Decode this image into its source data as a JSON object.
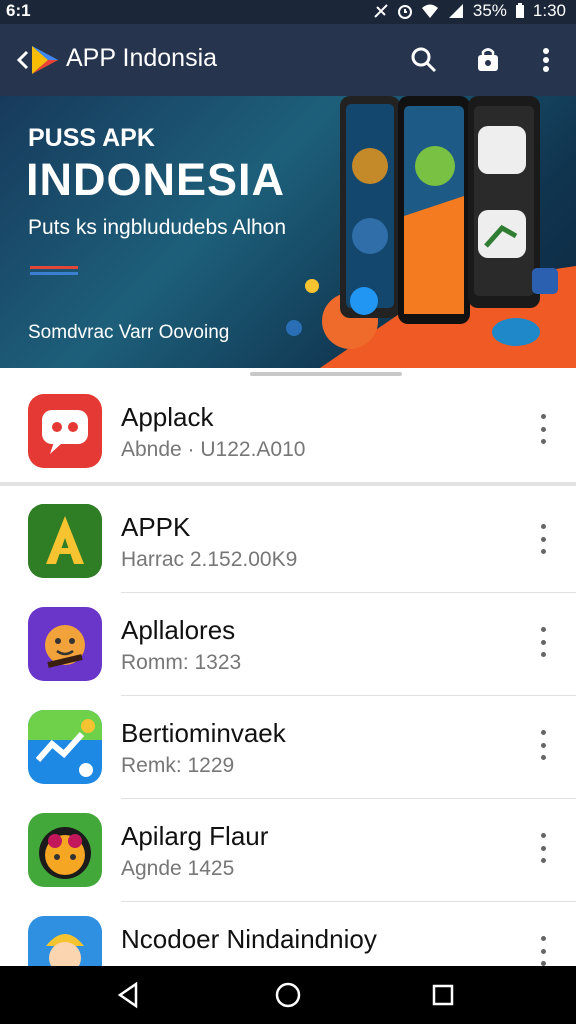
{
  "status_bar": {
    "time_left": "6:1",
    "battery": "35%",
    "clock": "1:30"
  },
  "app_bar": {
    "title": "APP Indonsia",
    "icons": [
      "back-arrow-icon",
      "app-logo-icon",
      "search-icon",
      "bag-icon",
      "more-vert-icon"
    ]
  },
  "banner": {
    "line1": "PUSS APK",
    "line2": "INDONESIA",
    "line3": "Puts ks ingblududebs Alhon",
    "line4": "Somdvrac Varr Oovoing"
  },
  "apps": [
    {
      "name": "Applack",
      "meta": "Abnde · U122.A010",
      "icon": "chat-bubble-icon",
      "color": "#e53935"
    },
    {
      "name": "APPK",
      "meta": "Harrac 2.152.00K9",
      "icon": "letter-a-icon",
      "color": "#3a8f2a"
    },
    {
      "name": "Apllalores",
      "meta": "Romm: 1323",
      "icon": "cartoon-face-icon",
      "color": "#6a35c9"
    },
    {
      "name": "Bertiominvaek",
      "meta": "Remk: 1229",
      "icon": "chart-trend-icon",
      "color": "#1e88e5"
    },
    {
      "name": "Apilarg Flaur",
      "meta": "Agnde 1425",
      "icon": "goggle-face-icon",
      "color": "#43a83a"
    },
    {
      "name": "Ncodoer Nindaindnioy",
      "meta": "",
      "icon": "person-icon",
      "color": "#2f8fe0"
    }
  ],
  "nav_bar": {
    "icons": [
      "back-triangle-icon",
      "home-circle-icon",
      "recents-square-icon"
    ]
  }
}
